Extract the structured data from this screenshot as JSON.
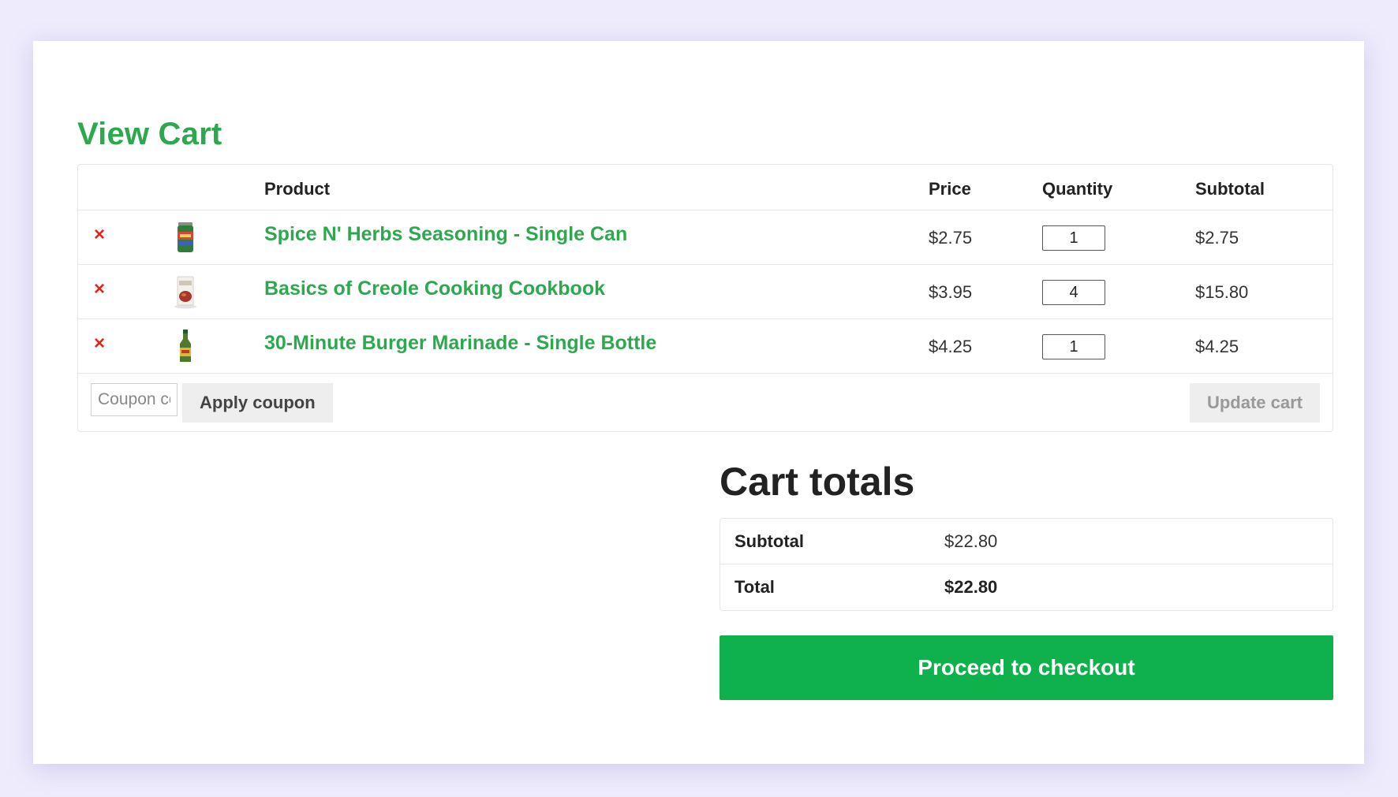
{
  "page": {
    "title": "View Cart"
  },
  "colors": {
    "background": "#eeebfc",
    "accent_green": "#2ea84f",
    "checkout_green": "#0fb14c",
    "remove_red": "#e2231a"
  },
  "cart_table": {
    "headers": {
      "product": "Product",
      "price": "Price",
      "quantity": "Quantity",
      "subtotal": "Subtotal"
    },
    "items": [
      {
        "remove_icon": "×",
        "thumbnail_icon": "seasoning-can-icon",
        "name": "Spice N' Herbs Seasoning - Single Can",
        "price": "$2.75",
        "quantity": "1",
        "subtotal": "$2.75"
      },
      {
        "remove_icon": "×",
        "thumbnail_icon": "cookbook-icon",
        "name": "Basics of Creole Cooking Cookbook",
        "price": "$3.95",
        "quantity": "4",
        "subtotal": "$15.80"
      },
      {
        "remove_icon": "×",
        "thumbnail_icon": "marinade-bottle-icon",
        "name": "30-Minute Burger Marinade - Single Bottle",
        "price": "$4.25",
        "quantity": "1",
        "subtotal": "$4.25"
      }
    ],
    "actions": {
      "coupon_placeholder": "Coupon code",
      "apply_coupon_label": "Apply coupon",
      "update_cart_label": "Update cart"
    }
  },
  "cart_totals": {
    "title": "Cart totals",
    "subtotal_label": "Subtotal",
    "subtotal_value": "$22.80",
    "total_label": "Total",
    "total_value": "$22.80",
    "checkout_label": "Proceed to checkout"
  }
}
